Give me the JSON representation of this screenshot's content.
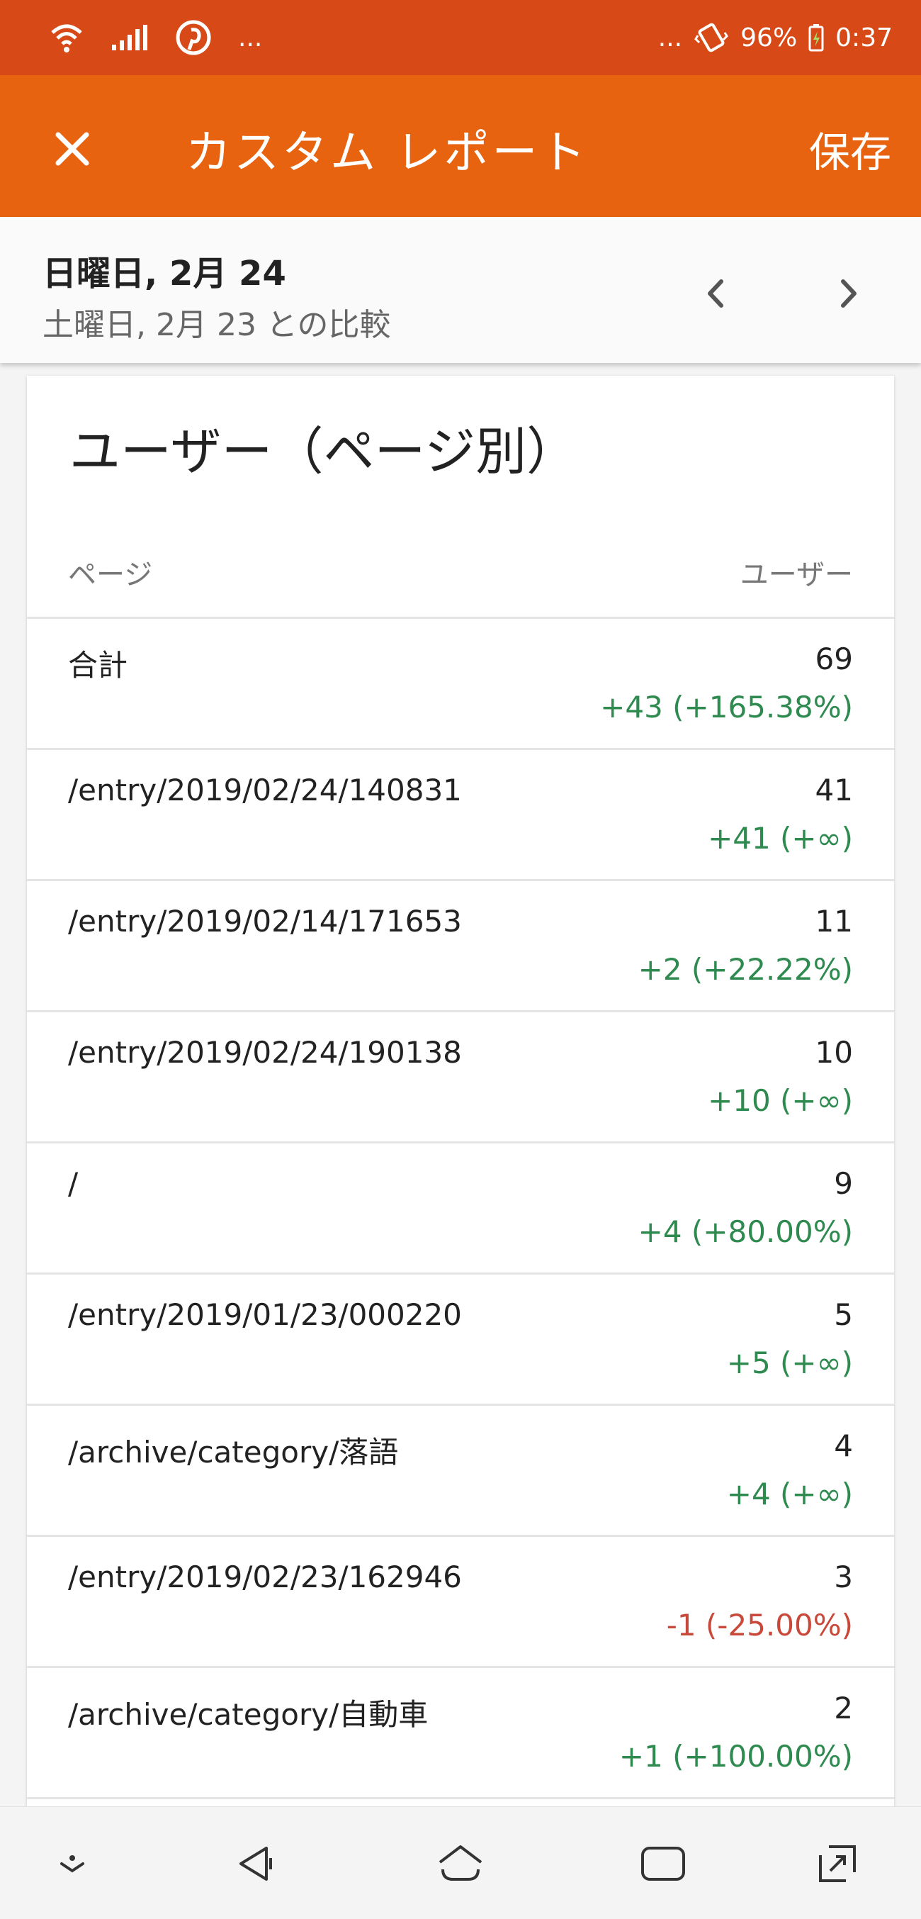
{
  "status_bar": {
    "left_icons": [
      "wifi-icon",
      "signal-icon",
      "pinterest-icon"
    ],
    "left_dots": "...",
    "right_dots": "...",
    "battery_percent": "96%",
    "time": "0:37"
  },
  "app_bar": {
    "close_icon": "close-icon",
    "title": "カスタム レポート",
    "save_label": "保存"
  },
  "date_bar": {
    "date": "日曜日, 2月 24",
    "compare": "土曜日, 2月 23 との比較"
  },
  "report": {
    "title": "ユーザー（ページ別）",
    "columns": {
      "page": "ページ",
      "users": "ユーザー"
    },
    "rows": [
      {
        "page": "合計",
        "users": "69",
        "delta": "+43 (+165.38%)",
        "trend": "up"
      },
      {
        "page": "/entry/2019/02/24/140831",
        "users": "41",
        "delta": "+41 (+∞)",
        "trend": "up"
      },
      {
        "page": "/entry/2019/02/14/171653",
        "users": "11",
        "delta": "+2 (+22.22%)",
        "trend": "up"
      },
      {
        "page": "/entry/2019/02/24/190138",
        "users": "10",
        "delta": "+10 (+∞)",
        "trend": "up"
      },
      {
        "page": "/",
        "users": "9",
        "delta": "+4 (+80.00%)",
        "trend": "up"
      },
      {
        "page": "/entry/2019/01/23/000220",
        "users": "5",
        "delta": "+5 (+∞)",
        "trend": "up"
      },
      {
        "page": "/archive/category/落語",
        "users": "4",
        "delta": "+4 (+∞)",
        "trend": "up"
      },
      {
        "page": "/entry/2019/02/23/162946",
        "users": "3",
        "delta": "-1 (-25.00%)",
        "trend": "down"
      },
      {
        "page": "/archive/category/自動車",
        "users": "2",
        "delta": "+1 (+100.00%)",
        "trend": "up"
      }
    ]
  },
  "colors": {
    "status_bar": "#d74a17",
    "app_bar": "#e8630f",
    "positive": "#2e8a4f",
    "negative": "#c8483a"
  },
  "nav_bar": [
    "dismiss-icon",
    "back-icon",
    "home-icon",
    "recents-icon",
    "screen-rotate-icon"
  ]
}
